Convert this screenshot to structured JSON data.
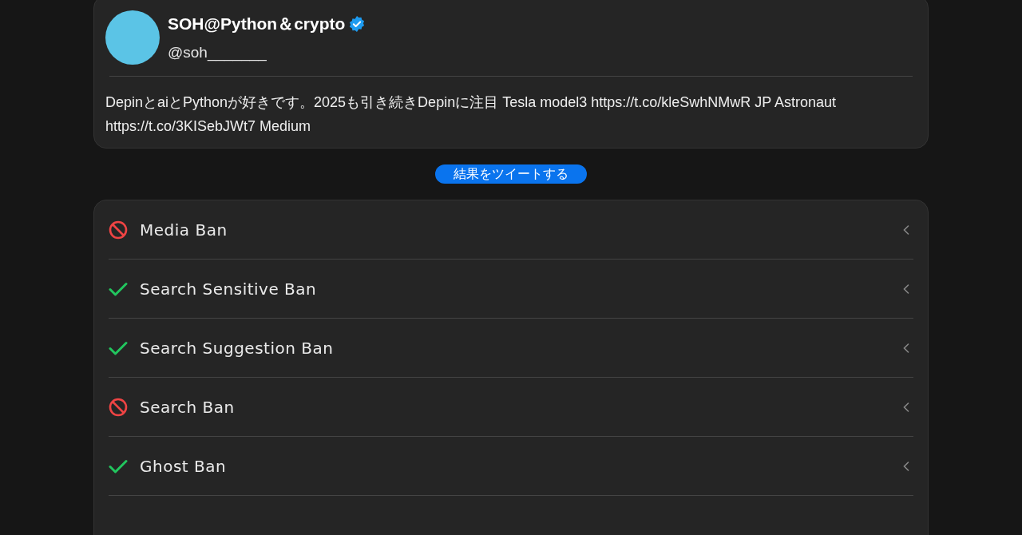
{
  "profile": {
    "name": "SOH@Python＆crypto",
    "verified": true,
    "handle": "@soh_______",
    "bio": "DepinとaiとPythonが好きです。2025も引き続きDepinに注目 Tesla model3 https://t.co/kleSwhNMwR JP Astronaut https://t.co/3KISebJWt7 Medium"
  },
  "tweet_button": "結果をツイートする",
  "checks": [
    {
      "label": "Media Ban",
      "banned": true,
      "expanded": false
    },
    {
      "label": "Search Sensitive Ban",
      "banned": false,
      "expanded": false
    },
    {
      "label": "Search Suggestion Ban",
      "banned": false,
      "expanded": false
    },
    {
      "label": "Search Ban",
      "banned": true,
      "expanded": false
    },
    {
      "label": "Ghost Ban",
      "banned": false,
      "expanded": false
    }
  ]
}
